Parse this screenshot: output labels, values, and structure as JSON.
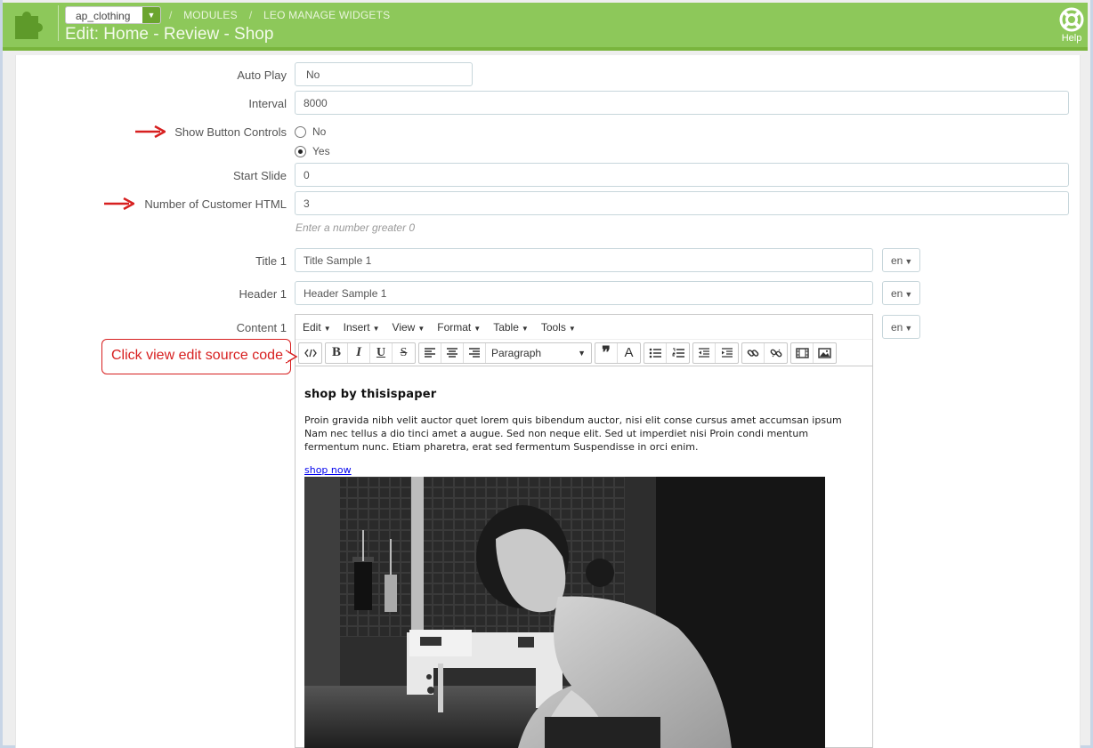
{
  "header": {
    "shop_select": "ap_clothing",
    "breadcrumb": [
      "MODULES",
      "LEO MANAGE WIDGETS"
    ],
    "title": "Edit: Home - Review - Shop",
    "help_label": "Help"
  },
  "form": {
    "auto_play": {
      "label": "Auto Play",
      "value": "No"
    },
    "interval": {
      "label": "Interval",
      "value": "8000"
    },
    "show_button_controls": {
      "label": "Show Button Controls",
      "options": [
        "No",
        "Yes"
      ],
      "selected": "Yes"
    },
    "start_slide": {
      "label": "Start Slide",
      "value": "0"
    },
    "number_of_customer_html": {
      "label": "Number of Customer HTML",
      "value": "3",
      "hint": "Enter a number greater 0"
    },
    "title_1": {
      "label": "Title 1",
      "value": "Title Sample 1",
      "lang": "en"
    },
    "header_1": {
      "label": "Header 1",
      "value": "Header Sample 1",
      "lang": "en"
    },
    "content_1": {
      "label": "Content 1",
      "lang": "en"
    }
  },
  "editor": {
    "menus": [
      "Edit",
      "Insert",
      "View",
      "Format",
      "Table",
      "Tools"
    ],
    "format_select": "Paragraph",
    "content": {
      "heading": "shop by thisispaper",
      "paragraph": "Proin gravida nibh velit auctor quet lorem quis bibendum auctor, nisi elit conse cursus amet accumsan ipsum Nam nec tellus a dio tinci amet a augue. Sed non neque elit. Sed ut imperdiet nisi Proin condi mentum fermentum nunc. Etiam pharetra, erat sed fermentum Suspendisse in orci enim.",
      "link": "shop now"
    }
  },
  "annotation": {
    "callout": "Click view edit source code",
    "color": "#d72020"
  },
  "colors": {
    "header_bg": "#8dc85a",
    "accent_dark": "#6ba52e"
  }
}
